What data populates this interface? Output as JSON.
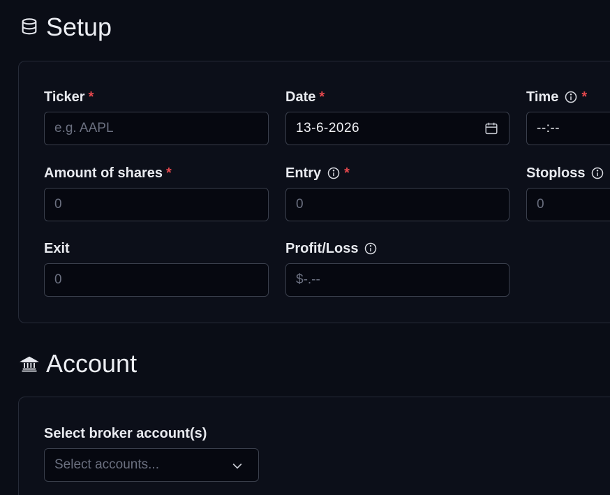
{
  "setup": {
    "title": "Setup",
    "fields": {
      "ticker": {
        "label": "Ticker",
        "placeholder": "e.g. AAPL"
      },
      "date": {
        "label": "Date",
        "value": "13-6-2026"
      },
      "time": {
        "label": "Time",
        "value": "--:--"
      },
      "shares": {
        "label": "Amount of shares",
        "placeholder": "0"
      },
      "entry": {
        "label": "Entry",
        "placeholder": "0"
      },
      "stoploss": {
        "label": "Stoploss",
        "placeholder": "0"
      },
      "exit": {
        "label": "Exit",
        "placeholder": "0"
      },
      "profit_loss": {
        "label": "Profit/Loss",
        "placeholder": "$-.--"
      }
    },
    "required_mark": "*"
  },
  "account": {
    "title": "Account",
    "broker_label": "Select broker account(s)",
    "broker_placeholder": "Select accounts..."
  },
  "icons": {
    "setup": "database-icon",
    "account": "bank-icon",
    "info": "info-icon",
    "calendar": "calendar-icon",
    "chevron": "chevron-down-icon"
  },
  "colors": {
    "background": "#0a0d16",
    "card": "#0c0f19",
    "border": "#3a3f4c",
    "required": "#e5484d",
    "placeholder": "#6b7080"
  }
}
